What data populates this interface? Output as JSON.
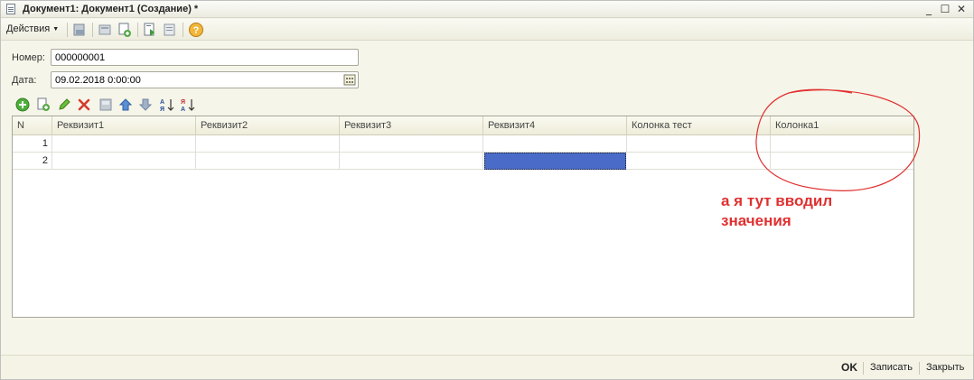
{
  "window": {
    "title": "Документ1: Документ1 (Создание) *",
    "minimize_glyph": "_",
    "maximize_glyph": "☐",
    "close_glyph": "✕"
  },
  "toolbar": {
    "actions_label": "Действия",
    "icons": [
      "post-document-icon",
      "cancel-posting-icon",
      "copy-icon",
      "structure-icon",
      "print-icon",
      "help-icon"
    ]
  },
  "form": {
    "number_label": "Номер:",
    "number_value": "000000001",
    "date_label": "Дата:",
    "date_value": "09.02.2018  0:00:00"
  },
  "table_toolbar": {
    "icons": [
      "add-row-icon",
      "copy-row-icon",
      "edit-row-icon",
      "delete-row-icon",
      "end-edit-icon",
      "move-up-icon",
      "move-down-icon",
      "sort-asc-icon",
      "sort-desc-icon"
    ]
  },
  "grid": {
    "columns": [
      "N",
      "Реквизит1",
      "Реквизит2",
      "Реквизит3",
      "Реквизит4",
      "Колонка тест",
      "Колонка1"
    ],
    "rows": [
      [
        "1",
        "",
        "",
        "",
        "",
        "",
        ""
      ],
      [
        "2",
        "",
        "",
        "",
        "",
        "",
        ""
      ]
    ],
    "selected_row": 2,
    "selected_column": "Реквизит4"
  },
  "annotation": {
    "line1": "а я тут вводил",
    "line2": "значения",
    "color": "#e03030"
  },
  "bottom_bar": {
    "ok_label": "OK",
    "save_label": "Записать",
    "close_label": "Закрыть"
  }
}
